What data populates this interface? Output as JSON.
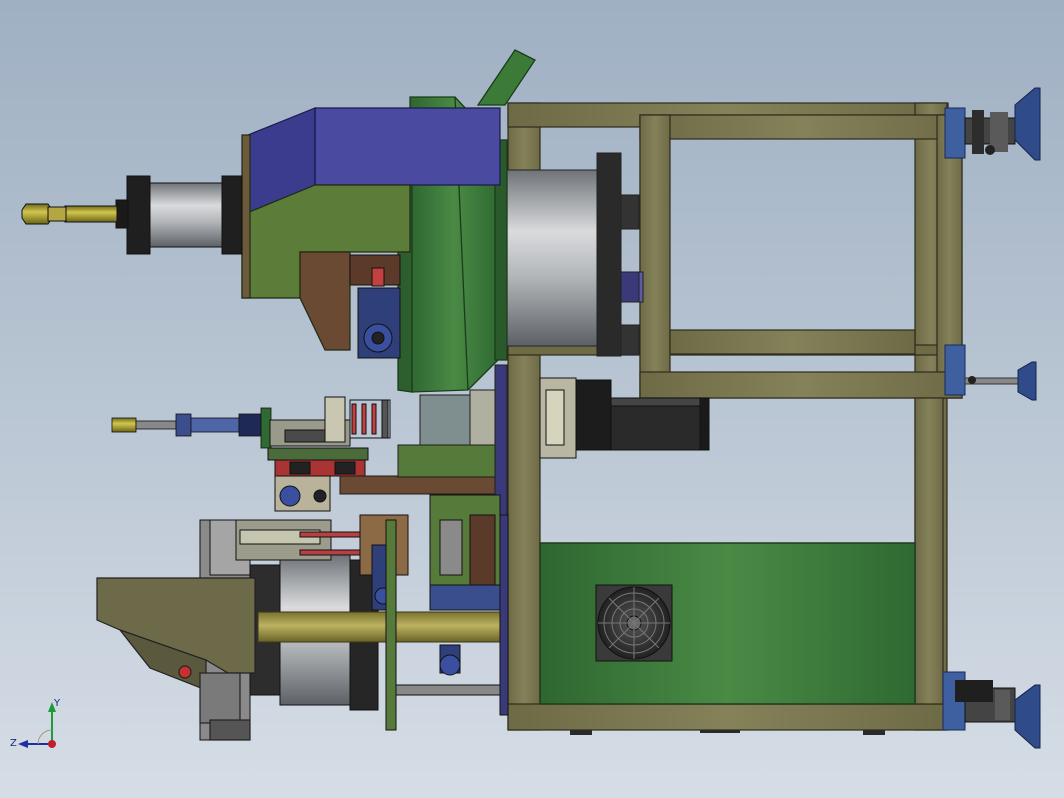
{
  "viewport": {
    "background_top": "#9fb0c3",
    "background_bottom": "#d6dde6"
  },
  "triad": {
    "y_label": "Y",
    "z_label": "Z",
    "y_color": "#1f9a3a",
    "z_color": "#1f2fa0",
    "origin_color": "#c0202a"
  },
  "colors": {
    "frame": "#77744f",
    "frame_dark": "#4b4a30",
    "green_panel": "#3f7a3a",
    "purple_hood": "#4a4aa0",
    "brass_rod": "#b7a93a",
    "foot_blue": "#2f4b8a"
  }
}
